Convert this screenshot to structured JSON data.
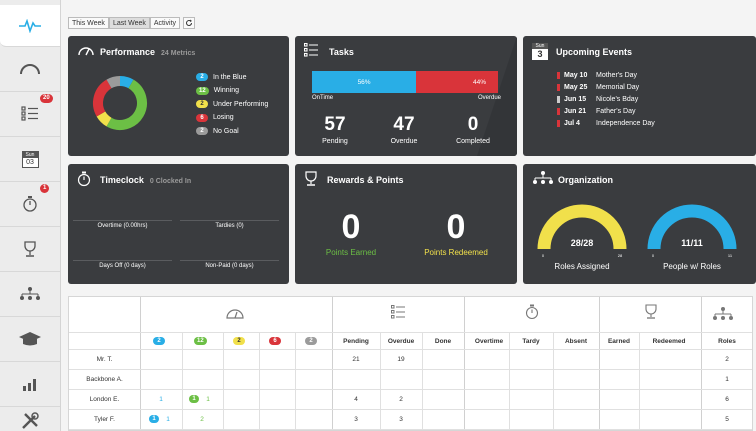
{
  "toolbar": {
    "this_week": "This Week",
    "last_week": "Last Week",
    "activity": "Activity"
  },
  "sidebar": {
    "badges": {
      "tasks": "20",
      "timeclock": "1"
    },
    "calendar_month": "Sun",
    "calendar_day": "03"
  },
  "performance": {
    "title": "Performance",
    "subtitle": "24 Metrics",
    "legend": [
      {
        "count": "2",
        "label": "In the Blue",
        "color": "#29aee6"
      },
      {
        "count": "12",
        "label": "Winning",
        "color": "#6cbf45"
      },
      {
        "count": "2",
        "label": "Under Performing",
        "color": "#f1e04b"
      },
      {
        "count": "6",
        "label": "Losing",
        "color": "#d9343a"
      },
      {
        "count": "2",
        "label": "No Goal",
        "color": "#9b9b9b"
      }
    ]
  },
  "tasks": {
    "title": "Tasks",
    "ontime_pct": "56%",
    "overdue_pct": "44%",
    "ontime_label": "OnTime",
    "overdue_label": "Overdue",
    "ontime_fraction": 0.56,
    "pending": "57",
    "pending_label": "Pending",
    "overdue": "47",
    "overdue_count_label": "Overdue",
    "completed": "0",
    "completed_label": "Completed"
  },
  "events": {
    "title": "Upcoming Events",
    "icon_month": "Sun",
    "icon_day": "3",
    "items": [
      {
        "date": "May 10",
        "name": "Mother's Day",
        "color": "#d9343a"
      },
      {
        "date": "May 25",
        "name": "Memorial Day",
        "color": "#d9343a"
      },
      {
        "date": "Jun 15",
        "name": "Nicole's Bday",
        "color": "#cccccc"
      },
      {
        "date": "Jun 21",
        "name": "Father's Day",
        "color": "#d9343a"
      },
      {
        "date": "Jul 4",
        "name": "Independence Day",
        "color": "#d9343a"
      }
    ]
  },
  "timeclock": {
    "title": "Timeclock",
    "subtitle": "0 Clocked In",
    "overtime": "Overtime (0.00hrs)",
    "tardies": "Tardies (0)",
    "daysoff": "Days Off (0 days)",
    "nonpaid": "Non-Paid (0 days)"
  },
  "rewards": {
    "title": "Rewards & Points",
    "earned": "0",
    "earned_label": "Points Earned",
    "redeemed": "0",
    "redeemed_label": "Points Redeemed"
  },
  "organization": {
    "title": "Organization",
    "roles_value": "28/28",
    "roles_min": "0",
    "roles_max": "28",
    "roles_label": "Roles Assigned",
    "roles_color": "#f1e04b",
    "people_value": "11/11",
    "people_min": "0",
    "people_max": "11",
    "people_label": "People w/ Roles",
    "people_color": "#29aee6"
  },
  "table": {
    "perf_pills": [
      "2",
      "12",
      "2",
      "6",
      "2"
    ],
    "headers": {
      "pending": "Pending",
      "overdue": "Overdue",
      "done": "Done",
      "overtime": "Overtime",
      "tardy": "Tardy",
      "absent": "Absent",
      "earned": "Earned",
      "redeemed": "Redeemed",
      "roles": "Roles"
    },
    "rows": [
      {
        "name": "Mr. T.",
        "pending": "21",
        "overdue": "19",
        "roles": "2"
      },
      {
        "name": "Backbone A.",
        "pending": "",
        "overdue": "",
        "roles": "1"
      },
      {
        "name": "London E.",
        "blue": "1",
        "green_pill": "1",
        "green_extra": "1",
        "pending": "4",
        "overdue": "2",
        "roles": "6"
      },
      {
        "name": "Tyler F.",
        "blue_pill": "1",
        "blue_extra": "1",
        "green": "2",
        "pending": "3",
        "overdue": "3",
        "roles": "5"
      }
    ]
  }
}
